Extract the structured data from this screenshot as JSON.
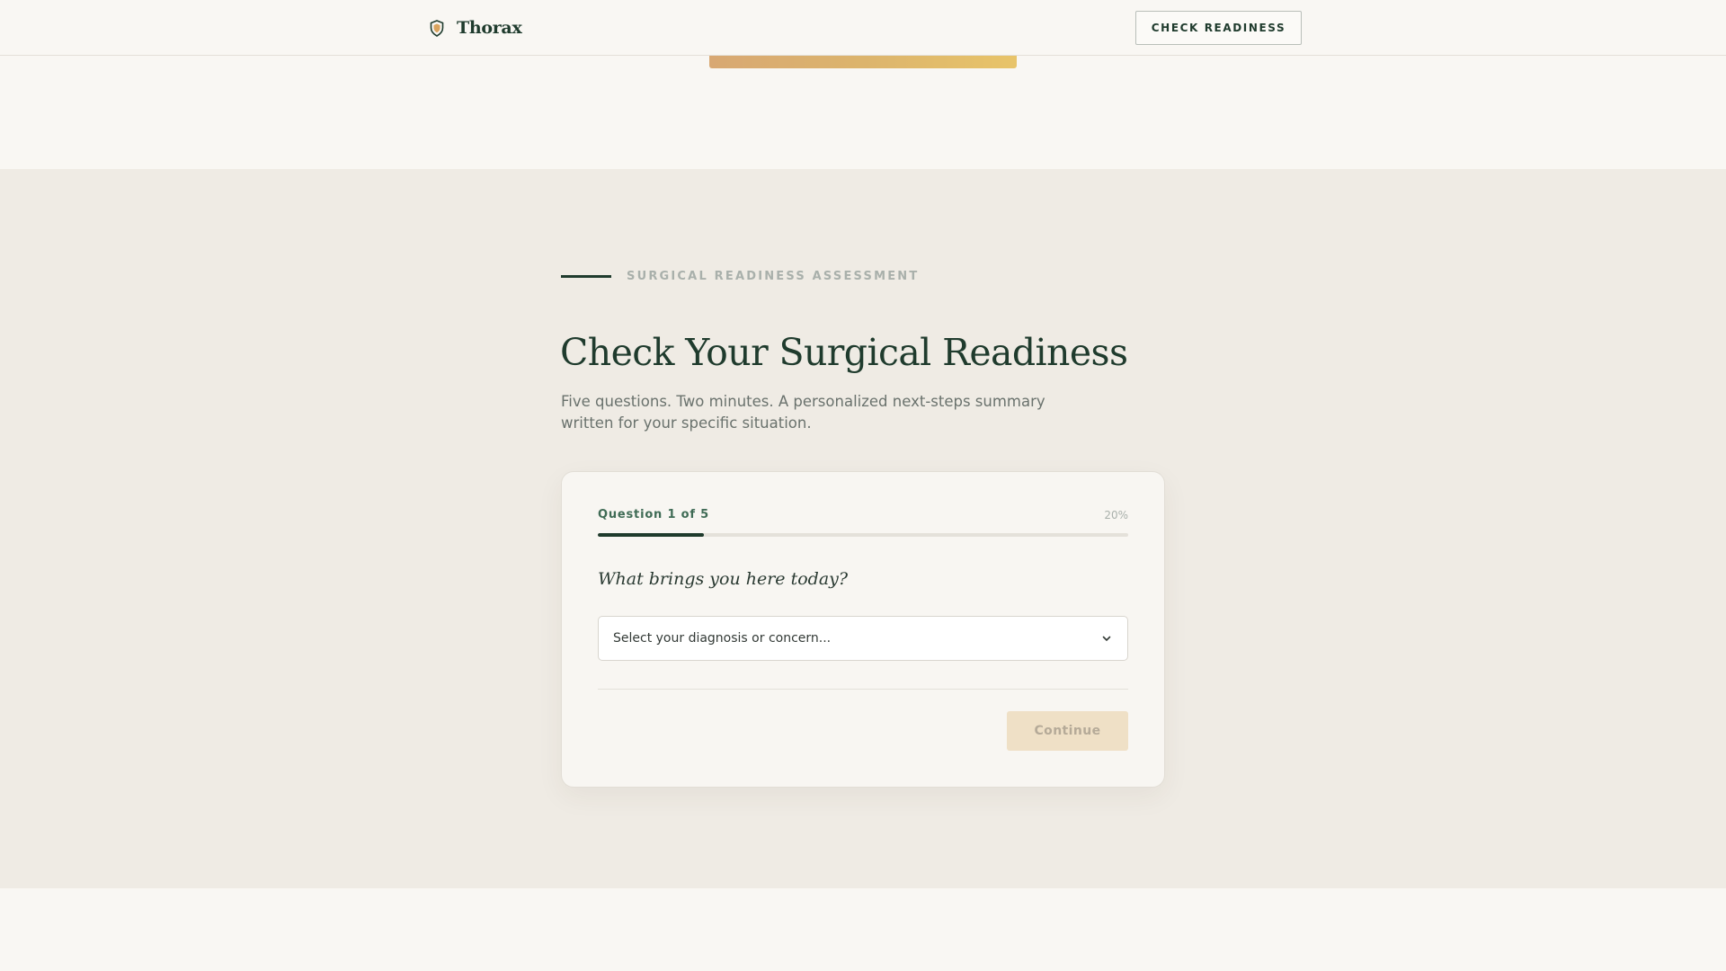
{
  "header": {
    "brand": "Thorax",
    "cta_label": "CHECK READINESS",
    "logo_icon": "shield-icon"
  },
  "assessment": {
    "eyebrow": "SURGICAL READINESS ASSESSMENT",
    "title": "Check Your Surgical Readiness",
    "subtitle": "Five questions. Two minutes. A personalized next-steps summary written for your specific situation.",
    "card": {
      "question_label": "Question 1 of 5",
      "progress_percent_label": "20%",
      "progress": 0.2,
      "question": "What brings you here today?",
      "select": {
        "placeholder": "Select your diagnosis or concern...",
        "icon": "chevron-down-icon"
      },
      "continue_label": "Continue",
      "continue_disabled": true
    }
  },
  "colors": {
    "brand_green": "#1f3b2d",
    "accent_gold": "#e0b86a",
    "section_bg": "#efebe4",
    "page_bg": "#f9f7f3"
  }
}
